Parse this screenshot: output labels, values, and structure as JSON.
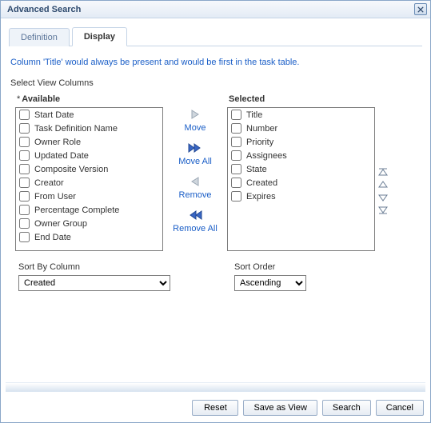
{
  "title": "Advanced Search",
  "tabs": {
    "definition": "Definition",
    "display": "Display"
  },
  "info": "Column 'Title' would always be present and would be first in the task table.",
  "section_label": "Select View Columns",
  "headers": {
    "available": "Available",
    "selected": "Selected"
  },
  "available": [
    "Start Date",
    "Task Definition Name",
    "Owner Role",
    "Updated Date",
    "Composite Version",
    "Creator",
    "From User",
    "Percentage Complete",
    "Owner Group",
    "End Date"
  ],
  "selected": [
    "Title",
    "Number",
    "Priority",
    "Assignees",
    "State",
    "Created",
    "Expires"
  ],
  "mover": {
    "move": "Move",
    "move_all": "Move All",
    "remove": "Remove",
    "remove_all": "Remove All"
  },
  "sort": {
    "by_label": "Sort By Column",
    "by_value": "Created",
    "order_label": "Sort Order",
    "order_value": "Ascending"
  },
  "buttons": {
    "reset": "Reset",
    "save_as_view": "Save as View",
    "search": "Search",
    "cancel": "Cancel"
  }
}
